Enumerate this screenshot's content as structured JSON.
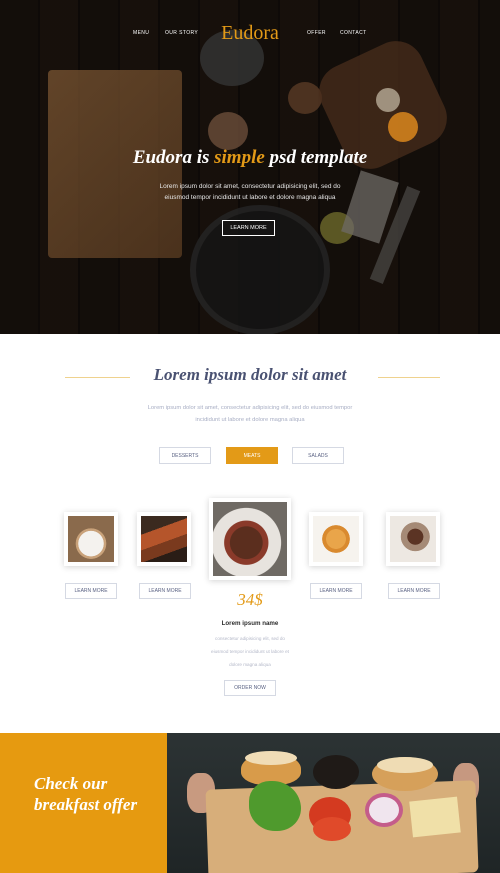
{
  "nav": {
    "left": [
      "MENU",
      "OUR STORY"
    ],
    "logo": "Eudora",
    "right": [
      "OFFER",
      "CONTACT"
    ]
  },
  "hero": {
    "title_start": "Eudora is ",
    "title_accent": "simple",
    "title_end": " psd template",
    "text": "Lorem ipsum dolor sit amet, consectetur adipisicing elit, sed do eiusmod tempor incididunt ut labore et dolore magna aliqua",
    "button": "LEARN MORE"
  },
  "menu_section": {
    "title": "Lorem ipsum dolor sit amet",
    "text": "Lorem ipsum dolor sit amet, consectetur adipisicing elit, sed do eiusmod tempor incididunt ut labore et dolore magna aliqua",
    "tabs": [
      "DESSERTS",
      "MEATS",
      "SALADS"
    ],
    "active_tab": "MEATS",
    "cards": [
      {
        "button": "LEARN MORE",
        "image": "plated-dish"
      },
      {
        "button": "LEARN MORE",
        "image": "grilled-skewers"
      },
      {
        "image": "steak-asparagus"
      },
      {
        "button": "LEARN MORE",
        "image": "pizza"
      },
      {
        "button": "LEARN MORE",
        "image": "meat-on-fork"
      }
    ],
    "featured": {
      "price": "34$",
      "name": "Lorem ipsum name",
      "description": "consectetur adipisicing elit, sed do eiusmod tempor incididunt ut labore et dolore magna aliqua",
      "button": "ORDER NOW"
    }
  },
  "breakfast": {
    "title": "Check our breakfast offer",
    "image": "burger-ingredients-board"
  },
  "colors": {
    "accent": "#e39a17",
    "heading": "#4a5272",
    "breakfast_panel": "#e69a10"
  }
}
